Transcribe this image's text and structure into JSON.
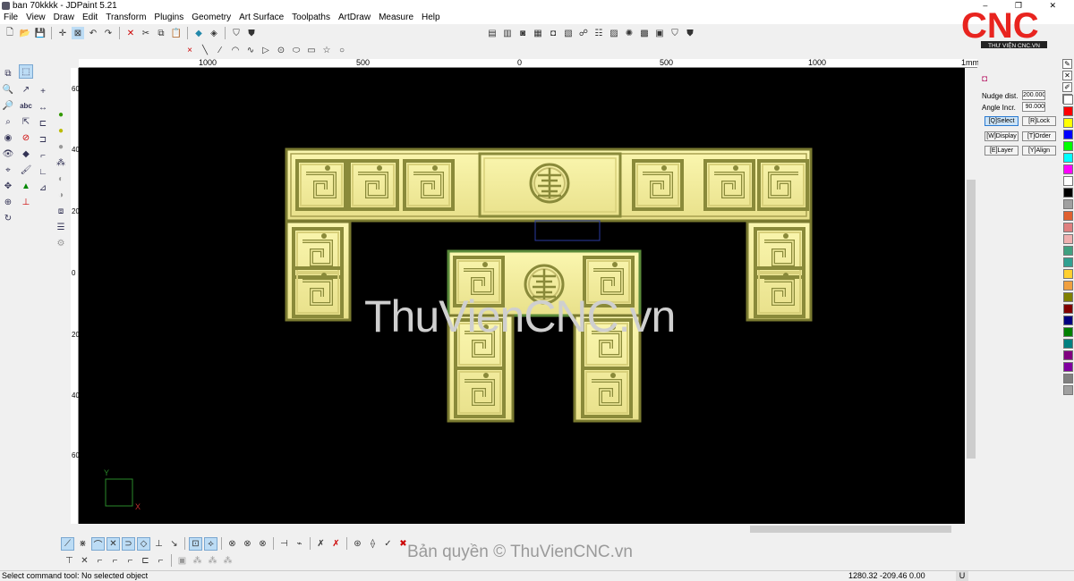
{
  "window": {
    "title": "ban 70kkkk - JDPaint 5.21",
    "controls": "–  ❐  ✕"
  },
  "menu": [
    "File",
    "View",
    "Draw",
    "Edit",
    "Transform",
    "Plugins",
    "Geometry",
    "Art Surface",
    "Toolpaths",
    "ArtDraw",
    "Measure",
    "Help"
  ],
  "ruler": {
    "top_labels": [
      "1000",
      "500",
      "0",
      "500",
      "1000",
      "1mm"
    ],
    "left_labels": [
      "600",
      "400",
      "200",
      "0",
      "200",
      "400",
      "600"
    ]
  },
  "panel": {
    "nudge_label": "Nudge dist.",
    "nudge_value": "200.000",
    "angle_label": "Angle Incr.",
    "angle_value": "90.000",
    "buttons": [
      "[Q]Select",
      "[R]Lock",
      "[W]Display",
      "[T]Order",
      "[E]Layer",
      "[Y]Align"
    ]
  },
  "palette": [
    "#ffffff",
    "#ff0000",
    "#ffff00",
    "#0000ff",
    "#00ff00",
    "#00ffff",
    "#ff00ff",
    "#ffffff",
    "#000000",
    "#a0a0a0",
    "#e06030",
    "#e08080",
    "#f0b0b0",
    "#40a080",
    "#30a090",
    "#ffd030",
    "#f0a040",
    "#808000",
    "#800000",
    "#000080",
    "#008000",
    "#008080",
    "#800080",
    "#8000a0",
    "#808080",
    "#a0a0a0"
  ],
  "status": {
    "message": "Select command tool: No selected object",
    "coords": "1280.32 -209.46 0.00",
    "unit": "U"
  },
  "watermarks": {
    "canvas": "ThuVienCNC.vn",
    "footer": "Bản quyền © ThuVienCNC.vn",
    "logo_main": "CNC",
    "logo_sub": "THƯ VIỆN CNC.VN"
  }
}
